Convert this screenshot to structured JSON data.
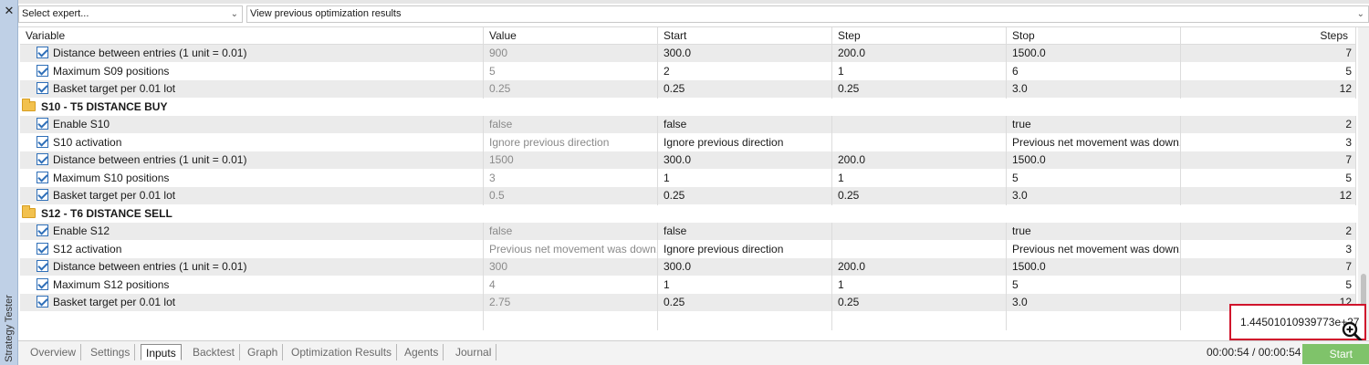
{
  "side": {
    "close_glyph": "✕",
    "panel_label": "Strategy Tester"
  },
  "toolbar": {
    "expert_select": "Select expert...",
    "results_select": "View previous optimization results"
  },
  "columns": [
    "Variable",
    "Value",
    "Start",
    "Step",
    "Stop",
    "Steps"
  ],
  "rows": [
    {
      "kind": "param",
      "variable": "Distance between entries (1 unit = 0.01)",
      "value": "900",
      "start": "300.0",
      "step": "200.0",
      "stop": "1500.0",
      "steps": "7"
    },
    {
      "kind": "param",
      "variable": "Maximum S09 positions",
      "value": "5",
      "start": "2",
      "step": "1",
      "stop": "6",
      "steps": "5"
    },
    {
      "kind": "param",
      "variable": "Basket target per 0.01 lot",
      "value": "0.25",
      "start": "0.25",
      "step": "0.25",
      "stop": "3.0",
      "steps": "12"
    },
    {
      "kind": "group",
      "variable": "S10 - T5 DISTANCE BUY"
    },
    {
      "kind": "param",
      "variable": "Enable S10",
      "value": "false",
      "start": "false",
      "step": "",
      "stop": "true",
      "steps": "2"
    },
    {
      "kind": "param",
      "variable": "S10 activation",
      "value": "Ignore previous direction",
      "start": "Ignore previous direction",
      "step": "",
      "stop": "Previous net movement was down...",
      "steps": "3"
    },
    {
      "kind": "param",
      "variable": "Distance between entries (1 unit = 0.01)",
      "value": "1500",
      "start": "300.0",
      "step": "200.0",
      "stop": "1500.0",
      "steps": "7"
    },
    {
      "kind": "param",
      "variable": "Maximum S10 positions",
      "value": "3",
      "start": "1",
      "step": "1",
      "stop": "5",
      "steps": "5"
    },
    {
      "kind": "param",
      "variable": "Basket target per 0.01 lot",
      "value": "0.5",
      "start": "0.25",
      "step": "0.25",
      "stop": "3.0",
      "steps": "12"
    },
    {
      "kind": "group",
      "variable": "S12 - T6 DISTANCE SELL"
    },
    {
      "kind": "param",
      "variable": "Enable S12",
      "value": "false",
      "start": "false",
      "step": "",
      "stop": "true",
      "steps": "2"
    },
    {
      "kind": "param",
      "variable": "S12 activation",
      "value": "Previous net movement was down...",
      "start": "Ignore previous direction",
      "step": "",
      "stop": "Previous net movement was down...",
      "steps": "3"
    },
    {
      "kind": "param",
      "variable": "Distance between entries (1 unit = 0.01)",
      "value": "300",
      "start": "300.0",
      "step": "200.0",
      "stop": "1500.0",
      "steps": "7"
    },
    {
      "kind": "param",
      "variable": "Maximum S12 positions",
      "value": "4",
      "start": "1",
      "step": "1",
      "stop": "5",
      "steps": "5"
    },
    {
      "kind": "param",
      "variable": "Basket target per 0.01 lot",
      "value": "2.75",
      "start": "0.25",
      "step": "0.25",
      "stop": "3.0",
      "steps": "12"
    }
  ],
  "total_combinations": "1.44501010939773e+27",
  "tabs": [
    {
      "label": "Overview",
      "active": false
    },
    {
      "label": "Settings",
      "active": false
    },
    {
      "label": "Inputs",
      "active": true
    },
    {
      "label": "Backtest",
      "active": false
    },
    {
      "label": "Graph",
      "active": false
    },
    {
      "label": "Optimization Results",
      "active": false
    },
    {
      "label": "Agents",
      "active": false
    },
    {
      "label": "Journal",
      "active": false
    }
  ],
  "timer": "00:00:54 / 00:00:54",
  "start_label": "Start",
  "colors": {
    "accent_highlight": "#d0142c",
    "start_button": "#7fc36a",
    "side_panel": "#bfd0e6",
    "checkbox": "#2f6fb8"
  }
}
